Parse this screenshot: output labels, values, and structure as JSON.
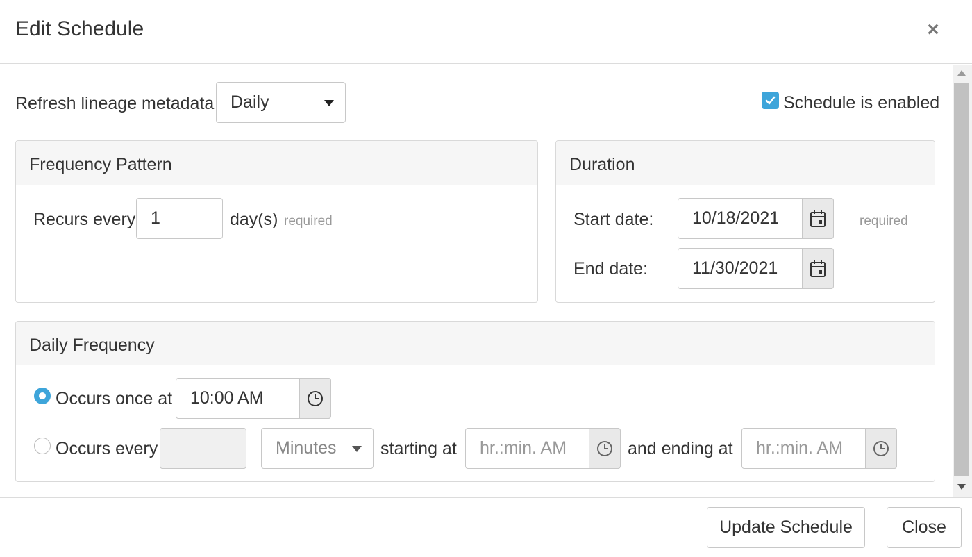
{
  "dialog": {
    "title": "Edit Schedule",
    "close_icon": "close-icon"
  },
  "schedule": {
    "refresh_label": "Refresh lineage metadata",
    "refresh_selected": "Daily",
    "enabled_label": "Schedule is enabled",
    "enabled_checked": true
  },
  "frequency_pattern": {
    "title": "Frequency Pattern",
    "recurs_label": "Recurs every",
    "recurs_value": "1",
    "unit_label": "day(s)",
    "required_label": "required"
  },
  "duration": {
    "title": "Duration",
    "start_label": "Start date:",
    "start_value": "10/18/2021",
    "end_label": "End date:",
    "end_value": "11/30/2021",
    "required_label": "required",
    "calendar_icon": "calendar-icon"
  },
  "daily_frequency": {
    "title": "Daily Frequency",
    "once_label": "Occurs once at",
    "once_value": "10:00 AM",
    "once_selected": true,
    "every_label": "Occurs every",
    "every_value": "",
    "every_unit_selected": "Minutes",
    "starting_label": "starting at",
    "starting_placeholder": "hr.:min. AM",
    "ending_label": "and ending at",
    "ending_placeholder": "hr.:min. AM",
    "clock_icon": "clock-icon"
  },
  "footer": {
    "update_label": "Update Schedule",
    "close_label": "Close"
  },
  "colors": {
    "accent": "#3ea5da",
    "panel_header_bg": "#f6f6f6",
    "border": "#c8c8c8"
  }
}
